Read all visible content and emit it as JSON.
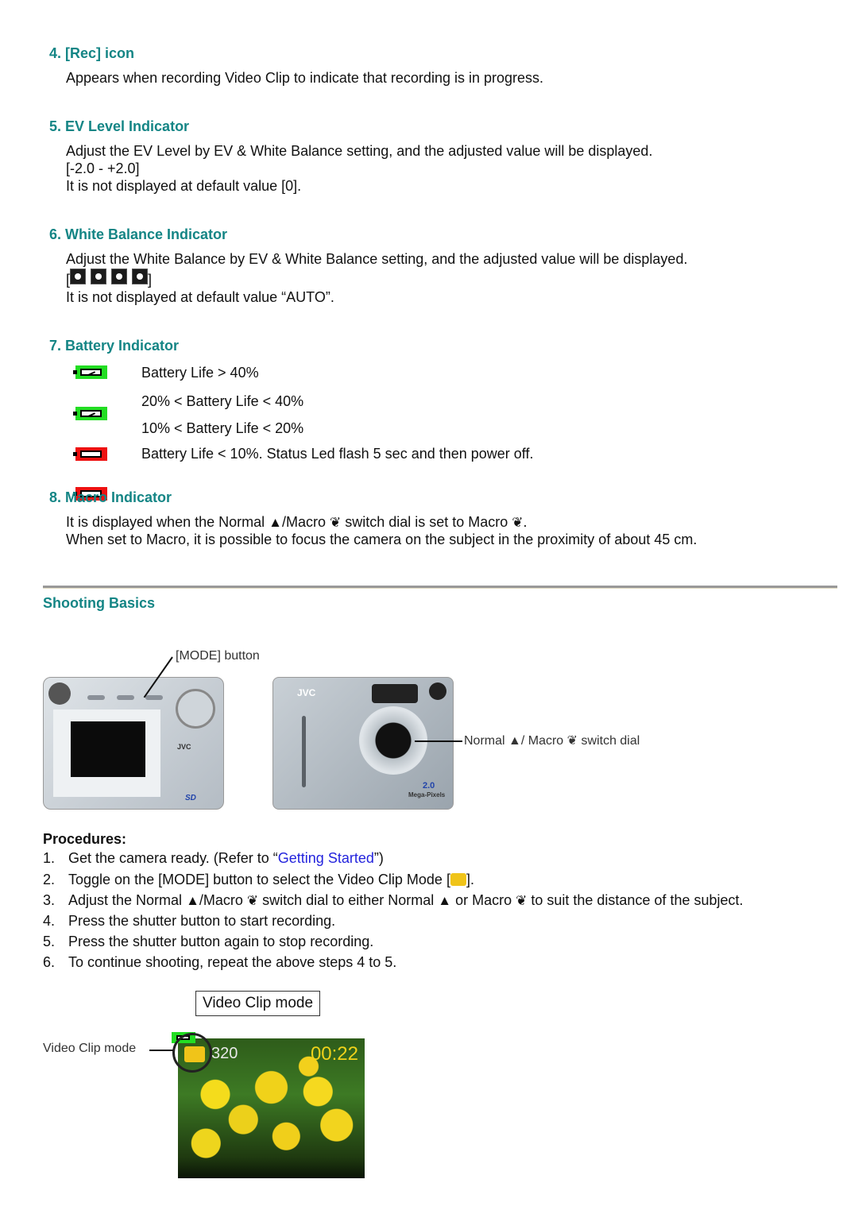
{
  "sections": [
    {
      "heading": "4. [Rec] icon",
      "lines": [
        "Appears when recording Video Clip to indicate that recording is in progress."
      ]
    },
    {
      "heading": "5. EV Level Indicator",
      "lines": [
        "Adjust the EV Level by EV & White Balance setting, and the adjusted value will be displayed.",
        "[-2.0 - +2.0]",
        "It is not displayed at default value [0]."
      ]
    },
    {
      "heading": "6. White Balance Indicator",
      "lines": [
        "Adjust the White Balance by EV & White Balance setting, and the adjusted value will be displayed.",
        "It is not displayed at default value “AUTO”."
      ],
      "icons": [
        "daylight-wb-icon",
        "fluorescent-wb-icon",
        "cloudy-wb-icon",
        "tungsten-wb-icon"
      ]
    },
    {
      "heading": "7. Battery Indicator"
    },
    {
      "heading": "8. Macro Indicator"
    }
  ],
  "battery": [
    {
      "label": "Battery Life > 40%",
      "color": "#22dd22",
      "state": "full"
    },
    {
      "label": "20% < Battery Life < 40%",
      "color": "#22dd22",
      "state": "half"
    },
    {
      "label": "10% < Battery Life < 20%",
      "color": "#ee1111",
      "state": "low"
    },
    {
      "label": "Battery Life < 10%. Status Led flash 5 sec and then power off.",
      "color": "#ee1111",
      "state": "empty"
    }
  ],
  "macro": {
    "line1_a": "It is displayed when the Normal ",
    "line1_b": "/Macro ",
    "line1_c": " switch dial is set to Macro ",
    "line1_d": ".",
    "line2": "When set to Macro, it is possible to focus the camera on the subject in the proximity of about 45 cm.",
    "normal_glyph": "▲",
    "macro_glyph": "❦"
  },
  "shooting": {
    "heading": "Shooting Basics",
    "mode_button_label": "[MODE] button",
    "switch_dial_label_a": "Normal ",
    "switch_dial_label_b": "/ Macro ",
    "switch_dial_label_c": " switch dial",
    "camera_brand": "JVC",
    "megapixels": "2.0",
    "megapixels_label": "Mega-Pixels"
  },
  "procedures": {
    "title": "Procedures:",
    "steps": [
      {
        "num": "1.",
        "text_a": "Get the camera ready. (Refer to “",
        "link": "Getting Started",
        "text_b": "”)"
      },
      {
        "num": "2.",
        "text_a": "Toggle on the [MODE] button to select the Video Clip Mode [",
        "text_b": "]."
      },
      {
        "num": "3.",
        "text_a": "Adjust the Normal ",
        "text_b": "/Macro ",
        "text_c": " switch dial to either Normal ",
        "text_d": " or Macro ",
        "text_e": " to suit the distance of the subject."
      },
      {
        "num": "4.",
        "text_a": "Press the shutter button to start recording."
      },
      {
        "num": "5.",
        "text_a": "Press the shutter button again to stop recording."
      },
      {
        "num": "6.",
        "text_a": "To continue shooting, repeat the above steps 4 to 5."
      }
    ]
  },
  "video_clip": {
    "box_label": "Video Clip mode",
    "callout_label": "Video Clip mode",
    "resolution": "320",
    "timer": "00:22",
    "timer_color": "#f0d21a"
  }
}
